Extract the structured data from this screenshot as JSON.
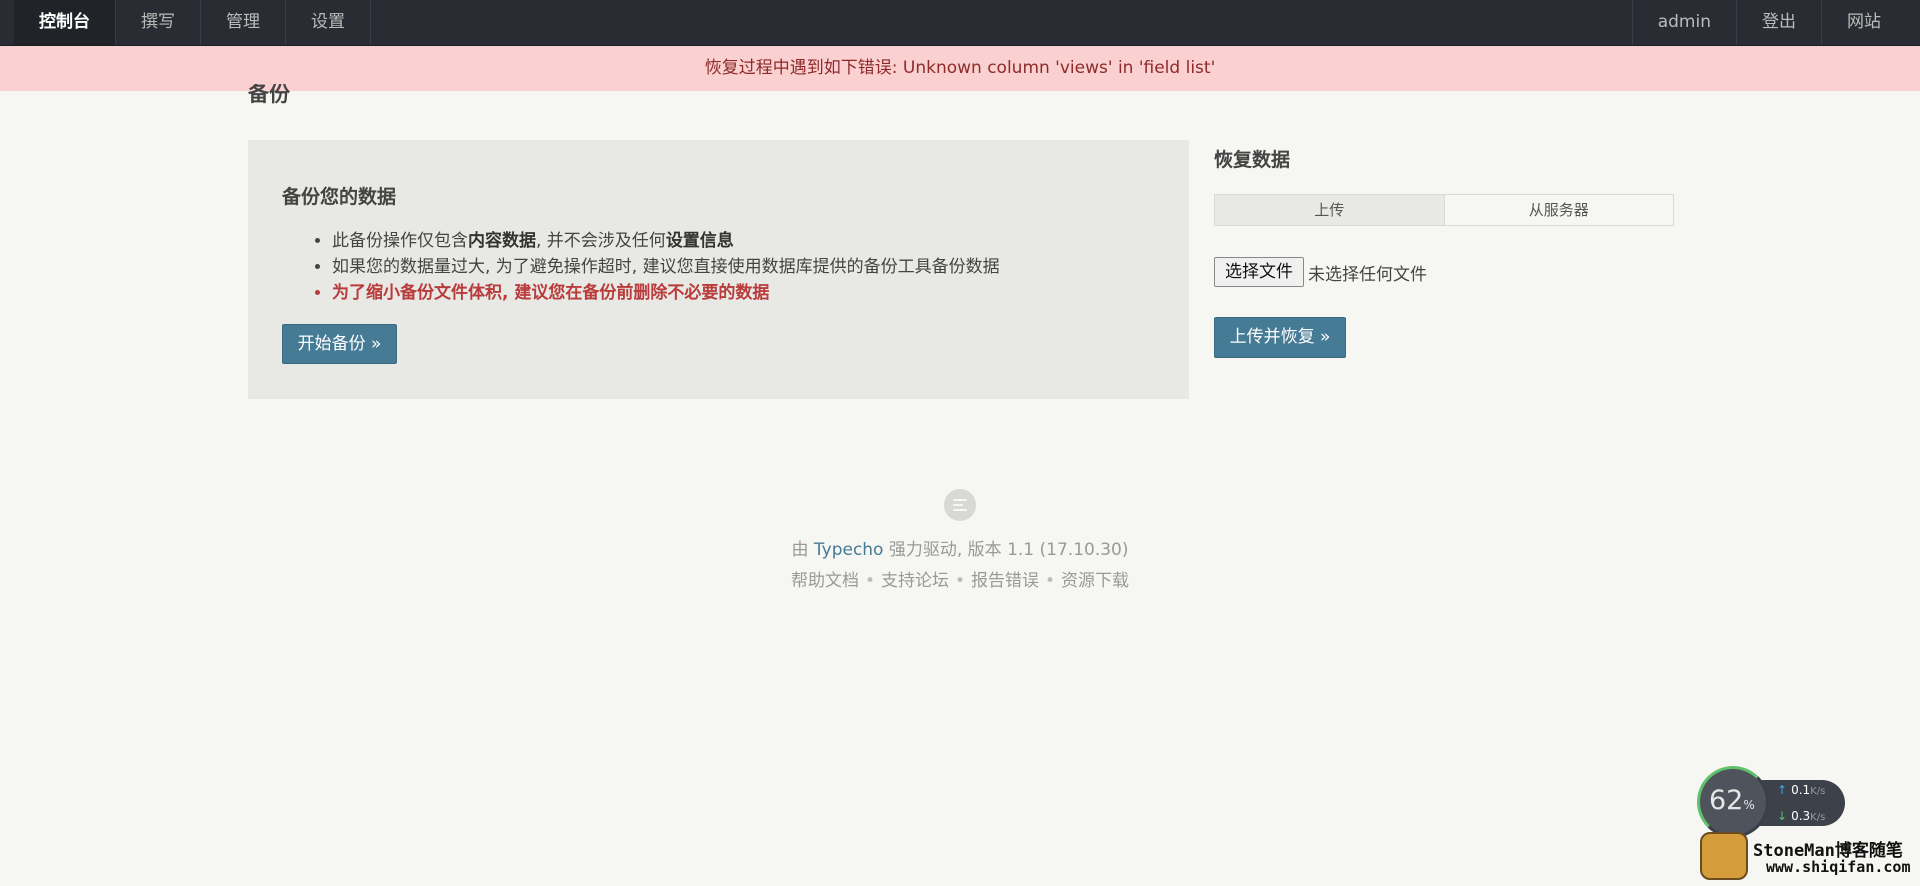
{
  "nav": {
    "left": [
      "控制台",
      "撰写",
      "管理",
      "设置"
    ],
    "active": "控制台",
    "right": [
      "admin",
      "登出",
      "网站"
    ]
  },
  "banner": {
    "message": "恢复过程中遇到如下错误: Unknown column 'views' in 'field list'"
  },
  "page": {
    "heading": "备份"
  },
  "backup": {
    "title": "备份您的数据",
    "item1_pre": "此备份操作仅包含",
    "item1_b1": "内容数据",
    "item1_mid": ", 并不会涉及任何",
    "item1_b2": "设置信息",
    "item2": "如果您的数据量过大, 为了避免操作超时, 建议您直接使用数据库提供的备份工具备份数据",
    "item3": "为了缩小备份文件体积, 建议您在备份前删除不必要的数据",
    "button": "开始备份 »"
  },
  "restore": {
    "title": "恢复数据",
    "tabs": [
      "上传",
      "从服务器"
    ],
    "active_tab": "上传",
    "file_button": "选择文件",
    "file_status": "未选择任何文件",
    "button": "上传并恢复 »"
  },
  "footer": {
    "by": "由",
    "brand": "Typecho",
    "powered": "强力驱动, 版本 1.1 (17.10.30)",
    "links": [
      "帮助文档",
      "支持论坛",
      "报告错误",
      "资源下载"
    ],
    "separator": "•"
  },
  "speed_widget": {
    "percent": "62",
    "percent_unit": "%",
    "up": "0.1",
    "down": "0.3",
    "unit": "K/s",
    "up_arrow": "↑",
    "down_arrow": "↓"
  },
  "watermark": {
    "name": "StoneMan博客随笔",
    "url": "www.shiqifan.com"
  }
}
